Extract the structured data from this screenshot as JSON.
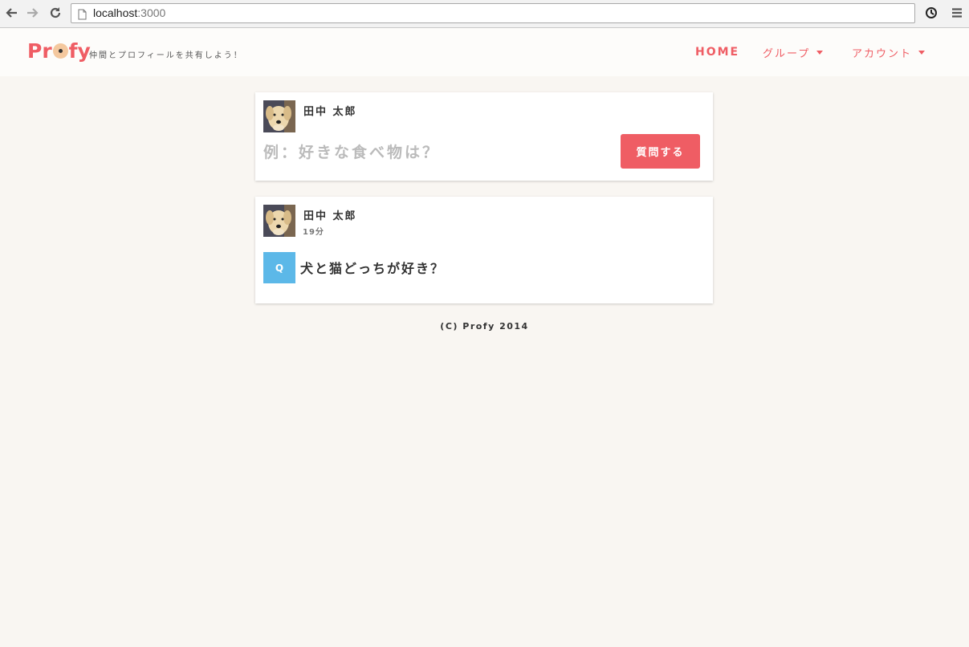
{
  "browser": {
    "url_host": "localhost",
    "url_port": ":3000"
  },
  "header": {
    "logo_pre": "Pr",
    "logo_post": "fy",
    "tagline": "仲間とプロフィールを共有しよう！",
    "nav": {
      "home": "HOME",
      "group": "グループ",
      "account": "アカウント"
    }
  },
  "ask_card": {
    "user_name": "田中 太郎",
    "input_placeholder": "例：好きな食べ物は？",
    "submit_label": "質問する"
  },
  "question_card": {
    "user_name": "田中 太郎",
    "time": "19分",
    "badge": "Q",
    "question": "犬と猫どっちが好き？"
  },
  "footer": {
    "text": "(C) Profy 2014"
  },
  "colors": {
    "accent": "#ef5d64",
    "badge": "#5cb8e8",
    "page_bg": "#f9f6f2"
  }
}
